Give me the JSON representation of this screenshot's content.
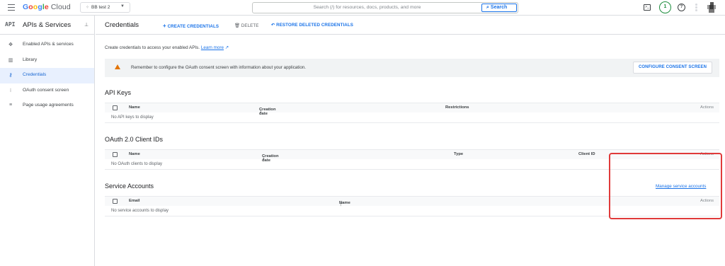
{
  "topbar": {
    "logo": {
      "g": "G",
      "o1": "o",
      "o2": "o",
      "g2": "g",
      "l": "l",
      "e": "e",
      "cloud": "Cloud"
    },
    "project": "BB test 2",
    "search_placeholder": "Search (/) for resources, docs, products, and more",
    "search_button": "Search",
    "notification_count": "1"
  },
  "sidebar": {
    "api_badge": "API",
    "title": "APIs & Services",
    "items": [
      {
        "label": "Enabled APIs & services",
        "icon": "enabled-apis-icon"
      },
      {
        "label": "Library",
        "icon": "library-icon"
      },
      {
        "label": "Credentials",
        "icon": "key-icon",
        "active": true
      },
      {
        "label": "OAuth consent screen",
        "icon": "consent-icon"
      },
      {
        "label": "Page usage agreements",
        "icon": "settings-list-icon"
      }
    ]
  },
  "header": {
    "title": "Credentials",
    "create": "CREATE CREDENTIALS",
    "delete": "DELETE",
    "restore": "RESTORE DELETED CREDENTIALS"
  },
  "intro": {
    "text": "Create credentials to access your enabled APIs.",
    "link": "Learn more"
  },
  "banner": {
    "message": "Remember to configure the OAuth consent screen with information about your application.",
    "button": "CONFIGURE CONSENT SCREEN"
  },
  "api_keys": {
    "title": "API Keys",
    "columns": {
      "name": "Name",
      "created": "Creation date",
      "restrictions": "Restrictions",
      "actions": "Actions"
    },
    "empty": "No API keys to display"
  },
  "oauth": {
    "title": "OAuth 2.0 Client IDs",
    "columns": {
      "name": "Name",
      "created": "Creation date",
      "type": "Type",
      "client_id": "Client ID",
      "actions": "Actions"
    },
    "empty": "No OAuth clients to display"
  },
  "service_accounts": {
    "title": "Service Accounts",
    "manage_link": "Manage service accounts",
    "columns": {
      "email": "Email",
      "name": "Name",
      "actions": "Actions"
    },
    "empty": "No service accounts to display"
  },
  "colors": {
    "accent": "#1a73e8",
    "highlight": "#e03a3a",
    "warning": "#e37400"
  }
}
